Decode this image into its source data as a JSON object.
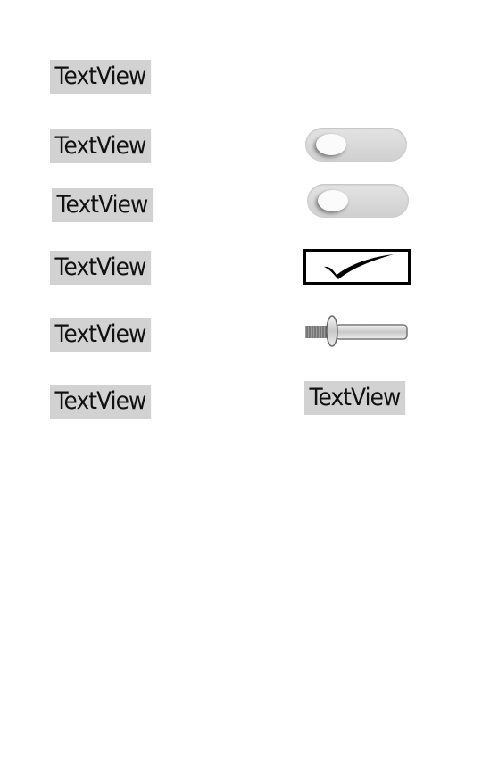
{
  "rows": [
    {
      "left_label": "TextView"
    },
    {
      "left_label": "TextView",
      "switch_checked": false
    },
    {
      "left_label": "TextView",
      "switch_checked": false
    },
    {
      "left_label": "TextView",
      "checkbox_checked": true
    },
    {
      "left_label": "TextView",
      "slider_value": 0.2
    },
    {
      "left_label": "TextView",
      "right_label": "TextView"
    }
  ],
  "colors": {
    "textview_bg": "#d2d2d2",
    "switch_track": "#d8d8d8"
  }
}
